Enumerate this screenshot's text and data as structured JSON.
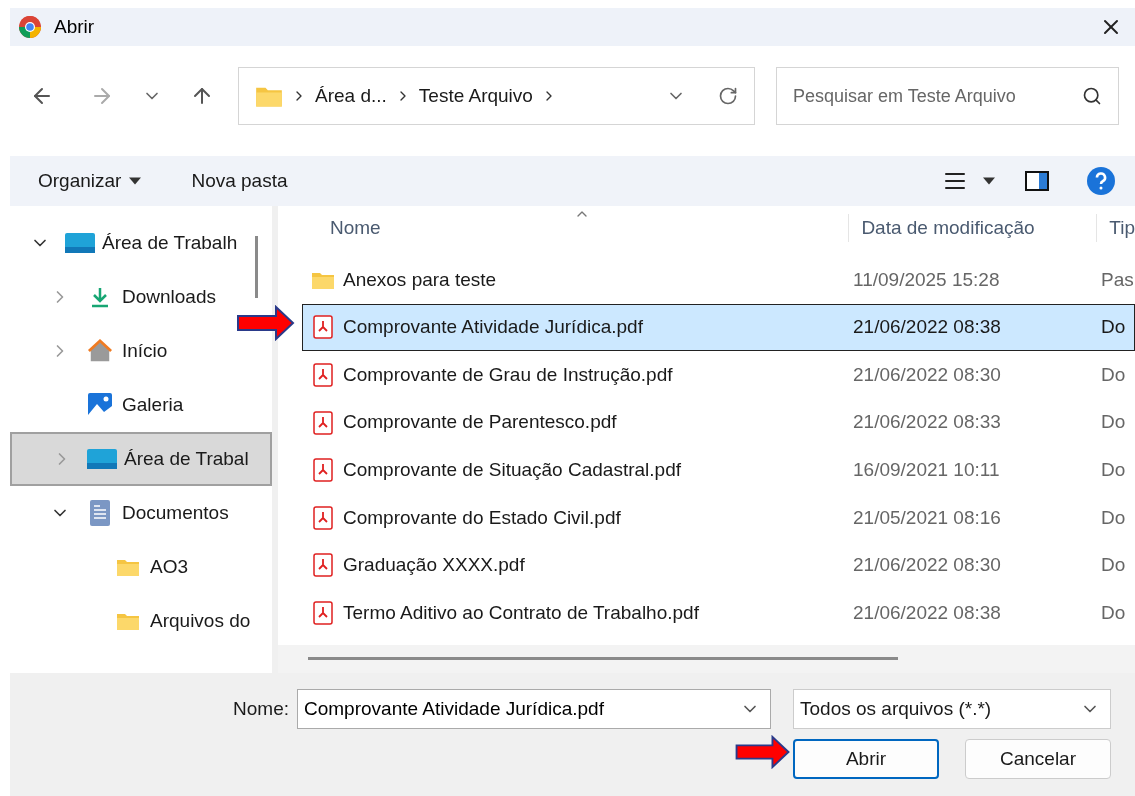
{
  "window": {
    "title": "Abrir"
  },
  "address": {
    "crumbs": [
      "Área d...",
      "Teste Arquivo"
    ]
  },
  "search": {
    "placeholder": "Pesquisar em Teste Arquivo"
  },
  "toolbar": {
    "organize": "Organizar",
    "new_folder": "Nova pasta"
  },
  "sidebar": {
    "items": [
      {
        "label": "Área de Trabalh",
        "kind": "desktop",
        "expanded": true,
        "selected": false,
        "children": [
          {
            "label": "Downloads",
            "kind": "download",
            "expanded": false,
            "selected": false
          },
          {
            "label": "Início",
            "kind": "home",
            "expanded": false,
            "selected": false
          },
          {
            "label": "Galeria",
            "kind": "gallery",
            "selected": false
          },
          {
            "label": "Área de Trabal",
            "kind": "desktop",
            "expanded": false,
            "selected": true
          },
          {
            "label": "Documentos",
            "kind": "document",
            "expanded": true,
            "selected": false,
            "children": [
              {
                "label": "AO3",
                "kind": "folder",
                "selected": false
              },
              {
                "label": "Arquivos do",
                "kind": "folder",
                "selected": false
              }
            ]
          }
        ]
      }
    ]
  },
  "table": {
    "columns": [
      "Nome",
      "Data de modificação",
      "Tip"
    ],
    "rows": [
      {
        "kind": "folder",
        "name": "Anexos para teste",
        "date": "11/09/2025 15:28",
        "type": "Pas",
        "selected": false
      },
      {
        "kind": "pdf",
        "name": "Comprovante Atividade Jurídica.pdf",
        "date": "21/06/2022 08:38",
        "type": "Do",
        "selected": true
      },
      {
        "kind": "pdf",
        "name": "Comprovante de Grau de Instrução.pdf",
        "date": "21/06/2022 08:30",
        "type": "Do",
        "selected": false
      },
      {
        "kind": "pdf",
        "name": "Comprovante de Parentesco.pdf",
        "date": "21/06/2022 08:33",
        "type": "Do",
        "selected": false
      },
      {
        "kind": "pdf",
        "name": "Comprovante de Situação Cadastral.pdf",
        "date": "16/09/2021 10:11",
        "type": "Do",
        "selected": false
      },
      {
        "kind": "pdf",
        "name": "Comprovante do Estado Civil.pdf",
        "date": "21/05/2021 08:16",
        "type": "Do",
        "selected": false
      },
      {
        "kind": "pdf",
        "name": "Graduação XXXX.pdf",
        "date": "21/06/2022 08:30",
        "type": "Do",
        "selected": false
      },
      {
        "kind": "pdf",
        "name": "Termo Aditivo ao Contrato de Trabalho.pdf",
        "date": "21/06/2022 08:38",
        "type": "Do",
        "selected": false
      }
    ]
  },
  "filename": {
    "label": "Nome:",
    "value": "Comprovante Atividade Jurídica.pdf"
  },
  "filetype": {
    "value": "Todos os arquivos (*.*)"
  },
  "buttons": [
    {
      "label": "Abrir",
      "kind": "primary"
    },
    {
      "label": "Cancelar",
      "kind": "secondary"
    }
  ]
}
